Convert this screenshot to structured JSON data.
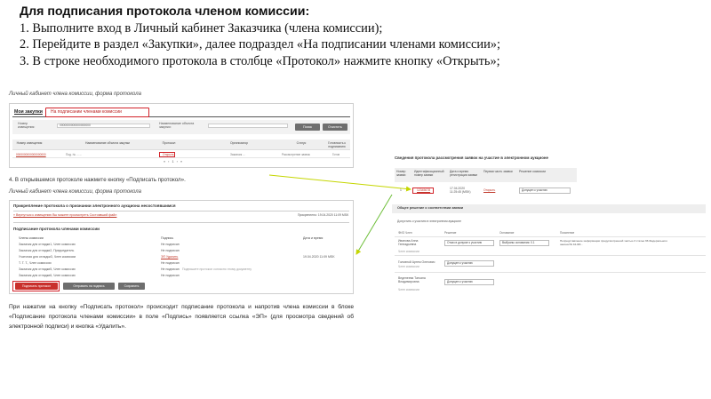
{
  "intro": {
    "heading": "Для подписания протокола членом комиссии:",
    "steps": [
      "1. Выполните вход в Личный кабинет Заказчика (члена комиссии);",
      "2. Перейдите в раздел «Закупки», далее подраздел «На подписании членами комиссии»;",
      "3. В строке необходимого протокола в столбце «Протокол» нажмите кнопку «Открыть»;"
    ]
  },
  "caption1": "Личный кабинет члена комиссии, форма протокола",
  "shot1": {
    "tab_main": "Мои закупки",
    "tab_active": "На подписании членами комиссии",
    "filter_label_1": "Номер извещения:",
    "filter_label_2": "Наименование объекта закупки:",
    "filter_value_1": "0000000000000000000",
    "search_button": "Поиск",
    "clear_button": "Очистить",
    "headers": [
      "Номер извещения",
      "Наименование объекта закупки",
      "Протокол",
      "Организатор",
      "Статус",
      "Готовность к подписанию"
    ],
    "row": {
      "number": "0000000000000000000",
      "name": "Под. № ... ...",
      "protocol": "Открыть",
      "organizer": "Заказчик ...",
      "status": "Рассмотрение заявок",
      "ready": "Готов"
    },
    "pager": "« ‹ 1 › »"
  },
  "step4": "4. В открывшемся протоколе нажмите кнопку «Подписать протокол».",
  "caption2": "Личный кабинет члена комиссии, форма протокола",
  "shot2": {
    "title": "Прикрепление протокола о признании электронного аукциона несостоявшимся",
    "links": "« Вернуться к извещению  Вы можете просмотреть Состоявший файл",
    "date": "Прикреплено: 19.04.2020 11:09 MSK",
    "subtitle": "Подписание протокола членами комиссии",
    "headers": [
      "Члены комиссии",
      "Подпись",
      "Дата и время"
    ],
    "rows": [
      {
        "member": "Заказчик для отладки1, Член комиссии",
        "sign": "Не подписан",
        "time": "",
        "hint": ""
      },
      {
        "member": "Заказчик для отладки2, Председатель",
        "sign": "Не подписан",
        "time": "",
        "hint": ""
      },
      {
        "member": "Учатсная для отладки3, Член комиссии",
        "sign": "ЭП Удалить",
        "time": "19.04.2020 11:09 MSK",
        "hint": ""
      },
      {
        "member": "Т. Т. Т., Член комиссии",
        "sign": "Не подписан",
        "time": "",
        "hint": ""
      },
      {
        "member": "Заказчик для отладки5, Член комиссии",
        "sign": "Не подписан",
        "time": "",
        "hint": "Подпишите протокол согласно этому документу"
      },
      {
        "member": "Заказчик для отладки6, Член комиссии",
        "sign": "Не подписан",
        "time": "",
        "hint": ""
      }
    ],
    "buttons": [
      "Подписать протокол",
      "Отправить на подпись",
      "Сохранить"
    ]
  },
  "note": "При нажатии на кнопку «Подписать протокол» происходит подписание протокола и напротив члена комиссии в блоке «Подписание протокола членами комиссии» в поле «Подпись» появляется ссылка «ЭП» (для просмотра сведений об электронной подписи) и кнопка «Удалить».",
  "shot3": {
    "title": "Сведения протокола рассмотрения заявок на участие в электронном аукционе",
    "headers": [
      "Номер заявки",
      "Идентификационный номер заявки",
      "Дата и время регистрации заявки",
      "Первая часть заявки",
      "Решение комиссии"
    ],
    "row": {
      "num": "1",
      "id": "12345678",
      "date": "17.04.2020 11:25:45 (MSK)",
      "first_part": "Открыть",
      "decision": "Допущен к участию"
    },
    "bar1": "Общее решение о соответствии заявки",
    "sub": "Допустить к участию в электронном аукционе",
    "grid_headers": [
      "ФИО Член",
      "Решение",
      "Основание",
      "Пояснение"
    ],
    "members": [
      {
        "name": "Иванова Анна Геннадьевна",
        "role": "Член комиссии",
        "decision": "Отказ в допуске к участию",
        "basis": "Выбраны основания: 0.1",
        "reason": "Непредставление информации предусмотренной частью 3 статьи 66 Федерального закона № 44-ФЗ..."
      },
      {
        "name": "Головной Артем Олегович",
        "role": "Член комиссии",
        "decision": "Допущен к участию",
        "basis": "",
        "reason": ""
      },
      {
        "name": "Веденеева Татьяна Владимировна",
        "role": "Член комиссии",
        "decision": "Допущен к участию",
        "basis": "",
        "reason": ""
      }
    ]
  },
  "colors": {
    "accent_red": "#d2232a",
    "arrow": "#c5d600",
    "button_gray": "#6e6e6e",
    "header_bg": "#efefef"
  }
}
